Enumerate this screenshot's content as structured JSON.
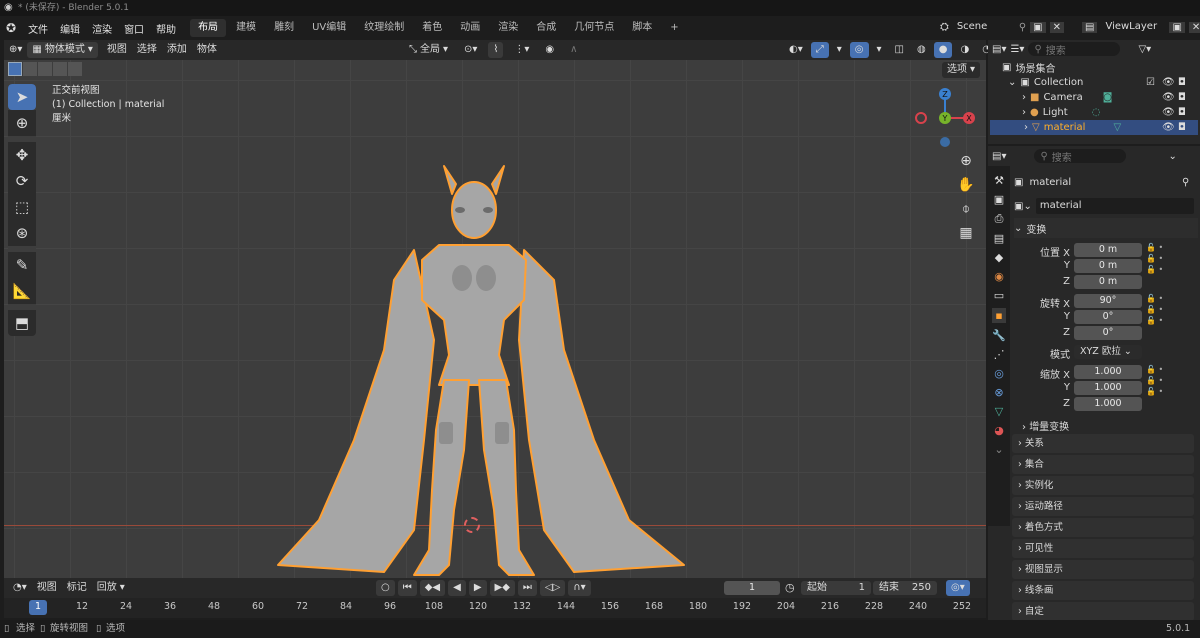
{
  "window": {
    "title": "* (未保存) - Blender 5.0.1"
  },
  "menu": [
    "文件",
    "编辑",
    "渲染",
    "窗口",
    "帮助"
  ],
  "workspaces": [
    {
      "label": "布局",
      "active": true
    },
    {
      "label": "建模"
    },
    {
      "label": "雕刻"
    },
    {
      "label": "UV编辑"
    },
    {
      "label": "纹理绘制"
    },
    {
      "label": "着色"
    },
    {
      "label": "动画"
    },
    {
      "label": "渲染"
    },
    {
      "label": "合成"
    },
    {
      "label": "几何节点"
    },
    {
      "label": "脚本"
    },
    {
      "label": "+"
    }
  ],
  "scene": {
    "name": "Scene",
    "view_layer": "ViewLayer"
  },
  "viewport_header": {
    "mode": "物体模式",
    "menus": [
      "视图",
      "选择",
      "添加",
      "物体"
    ],
    "transform_orientation": "全局",
    "options_label": "选项"
  },
  "viewport": {
    "view_name": "正交前视图",
    "collection_line": "(1) Collection | material",
    "units": "厘米"
  },
  "gizmo": {
    "z": "Z",
    "y": "Y",
    "x": "X"
  },
  "timeline": {
    "menus": [
      "视图",
      "标记",
      "回放"
    ],
    "current_frame": "1",
    "start_label": "起始",
    "start": "1",
    "end_label": "结束",
    "end": "250",
    "ticks": [
      "1",
      "12",
      "24",
      "36",
      "48",
      "60",
      "72",
      "84",
      "96",
      "108",
      "120",
      "132",
      "144",
      "156",
      "168",
      "180",
      "192",
      "204",
      "216",
      "228",
      "240",
      "252"
    ]
  },
  "statusbar": {
    "select": "选择",
    "rotate": "旋转视图",
    "options": "选项",
    "version": "5.0.1"
  },
  "outliner": {
    "search_placeholder": "搜索",
    "scene_collection": "场景集合",
    "collection": "Collection",
    "items": [
      {
        "label": "Camera"
      },
      {
        "label": "Light"
      },
      {
        "label": "material",
        "selected": true
      }
    ]
  },
  "properties": {
    "search_placeholder": "搜索",
    "object_name": "material",
    "data_name": "material",
    "transform": {
      "title": "变换",
      "location": {
        "label": "位置 X",
        "y": "Y",
        "z": "Z",
        "values": [
          "0 m",
          "0 m",
          "0 m"
        ]
      },
      "rotation": {
        "label": "旋转 X",
        "y": "Y",
        "z": "Z",
        "values": [
          "90°",
          "0°",
          "0°"
        ]
      },
      "mode_label": "模式",
      "mode_value": "XYZ 欧拉",
      "scale": {
        "label": "缩放 X",
        "y": "Y",
        "z": "Z",
        "values": [
          "1.000",
          "1.000",
          "1.000"
        ]
      },
      "delta": "增量变换"
    },
    "panels": [
      "关系",
      "集合",
      "实例化",
      "运动路径",
      "着色方式",
      "可见性",
      "视图显示",
      "线条画",
      "自定"
    ]
  },
  "colors": {
    "accent": "#4772b3",
    "selection": "#ffa033",
    "x_axis": "#d8424c",
    "y_axis": "#77b32a",
    "z_axis": "#3a80d0"
  }
}
